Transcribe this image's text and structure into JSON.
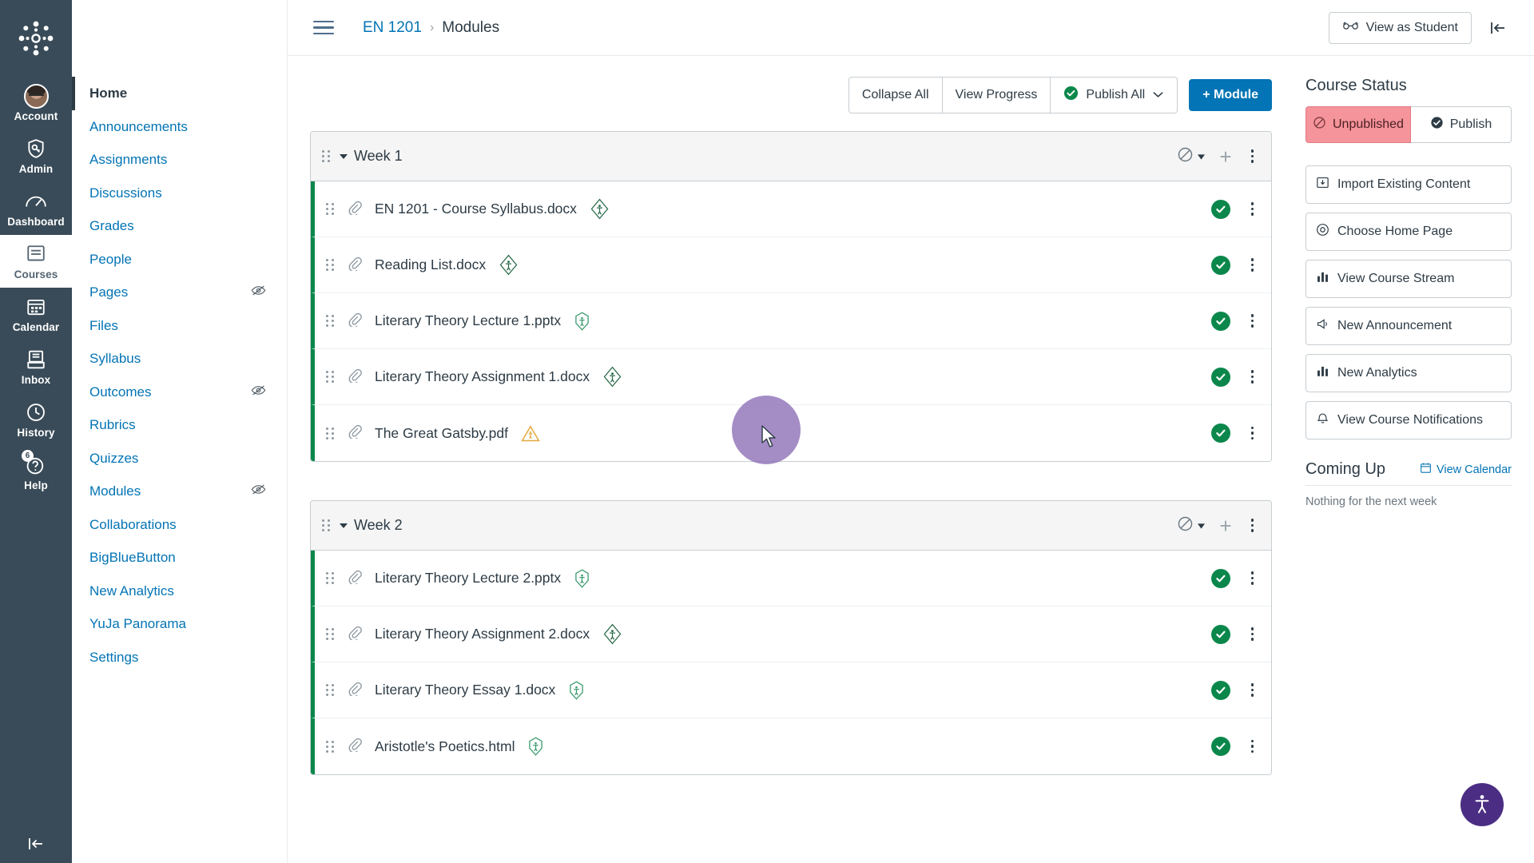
{
  "global_nav": {
    "logo": "canvas-logo",
    "items": [
      {
        "label": "Account",
        "icon": "avatar-icon",
        "active": false
      },
      {
        "label": "Admin",
        "icon": "shield-key-icon",
        "active": false
      },
      {
        "label": "Dashboard",
        "icon": "dashboard-gauge-icon",
        "active": false
      },
      {
        "label": "Courses",
        "icon": "book-icon",
        "active": true
      },
      {
        "label": "Calendar",
        "icon": "calendar-icon",
        "active": false
      },
      {
        "label": "Inbox",
        "icon": "inbox-tray-icon",
        "active": false
      },
      {
        "label": "History",
        "icon": "clock-icon",
        "active": false
      },
      {
        "label": "Help",
        "icon": "question-circle-icon",
        "active": false,
        "badge": "6"
      }
    ],
    "collapse_icon": "collapse-left-icon"
  },
  "course_nav": {
    "items": [
      {
        "label": "Home",
        "active": true,
        "hidden_icon": false
      },
      {
        "label": "Announcements",
        "active": false,
        "hidden_icon": false
      },
      {
        "label": "Assignments",
        "active": false,
        "hidden_icon": false
      },
      {
        "label": "Discussions",
        "active": false,
        "hidden_icon": false
      },
      {
        "label": "Grades",
        "active": false,
        "hidden_icon": false
      },
      {
        "label": "People",
        "active": false,
        "hidden_icon": false
      },
      {
        "label": "Pages",
        "active": false,
        "hidden_icon": true
      },
      {
        "label": "Files",
        "active": false,
        "hidden_icon": false
      },
      {
        "label": "Syllabus",
        "active": false,
        "hidden_icon": false
      },
      {
        "label": "Outcomes",
        "active": false,
        "hidden_icon": true
      },
      {
        "label": "Rubrics",
        "active": false,
        "hidden_icon": false
      },
      {
        "label": "Quizzes",
        "active": false,
        "hidden_icon": false
      },
      {
        "label": "Modules",
        "active": false,
        "hidden_icon": true
      },
      {
        "label": "Collaborations",
        "active": false,
        "hidden_icon": false
      },
      {
        "label": "BigBlueButton",
        "active": false,
        "hidden_icon": false
      },
      {
        "label": "New Analytics",
        "active": false,
        "hidden_icon": false
      },
      {
        "label": "YuJa Panorama",
        "active": false,
        "hidden_icon": false
      },
      {
        "label": "Settings",
        "active": false,
        "hidden_icon": false
      }
    ]
  },
  "topbar": {
    "menu_icon": "hamburger-menu-icon",
    "breadcrumb_course": "EN 1201",
    "breadcrumb_sep": "›",
    "breadcrumb_current": "Modules",
    "view_as_student_label": "View as Student",
    "view_as_student_icon": "eye-glasses-icon",
    "collapse_icon": "collapse-right-icon"
  },
  "module_actions": {
    "collapse_all": "Collapse All",
    "view_progress": "View Progress",
    "publish_all": "Publish All",
    "publish_all_icon": "green-check-circle-icon",
    "publish_all_caret": "chevron-down-icon",
    "add_module": "+ Module"
  },
  "modules": [
    {
      "title": "Week 1",
      "publish_state_icon": "prohibited-circle-icon",
      "add_icon": "plus-icon",
      "kebab_icon": "kebab-menu-icon",
      "items": [
        {
          "title": "EN 1201 - Course Syllabus.docx",
          "type_icon": "paperclip-icon",
          "badge": "a11y-diamond-icon",
          "published": true
        },
        {
          "title": "Reading List.docx",
          "type_icon": "paperclip-icon",
          "badge": "a11y-diamond-icon",
          "published": true
        },
        {
          "title": "Literary Theory Lecture 1.pptx",
          "type_icon": "paperclip-icon",
          "badge": "a11y-hexagon-icon",
          "published": true
        },
        {
          "title": "Literary Theory Assignment 1.docx",
          "type_icon": "paperclip-icon",
          "badge": "a11y-diamond-icon",
          "published": true
        },
        {
          "title": "The Great Gatsby.pdf",
          "type_icon": "paperclip-icon",
          "badge": "a11y-warning-triangle-icon",
          "published": true
        }
      ]
    },
    {
      "title": "Week 2",
      "publish_state_icon": "prohibited-circle-icon",
      "add_icon": "plus-icon",
      "kebab_icon": "kebab-menu-icon",
      "items": [
        {
          "title": "Literary Theory Lecture 2.pptx",
          "type_icon": "paperclip-icon",
          "badge": "a11y-hexagon-icon",
          "published": true
        },
        {
          "title": "Literary Theory Assignment 2.docx",
          "type_icon": "paperclip-icon",
          "badge": "a11y-diamond-icon",
          "published": true
        },
        {
          "title": "Literary Theory Essay 1.docx",
          "type_icon": "paperclip-icon",
          "badge": "a11y-hexagon-icon",
          "published": true
        },
        {
          "title": "Aristotle's Poetics.html",
          "type_icon": "paperclip-icon",
          "badge": "a11y-hexagon-icon",
          "published": true
        }
      ]
    }
  ],
  "sidebar": {
    "course_status_title": "Course Status",
    "unpublished_label": "Unpublished",
    "unpublished_icon": "prohibited-circle-icon",
    "publish_label": "Publish",
    "publish_icon": "check-circle-icon",
    "buttons": [
      {
        "label": "Import Existing Content",
        "icon": "import-icon"
      },
      {
        "label": "Choose Home Page",
        "icon": "home-target-icon"
      },
      {
        "label": "View Course Stream",
        "icon": "bar-chart-icon"
      },
      {
        "label": "New Announcement",
        "icon": "megaphone-icon"
      },
      {
        "label": "New Analytics",
        "icon": "bar-chart-icon"
      },
      {
        "label": "View Course Notifications",
        "icon": "bell-icon"
      }
    ],
    "coming_up_title": "Coming Up",
    "view_calendar_label": "View Calendar",
    "view_calendar_icon": "calendar-icon",
    "nothing_text": "Nothing for the next week"
  },
  "overlays": {
    "accessibility_fab_icon": "accessibility-person-icon",
    "cursor_icon": "mouse-pointer-icon"
  },
  "colors": {
    "brand_blue": "#0374B5",
    "nav_dark": "#394B58",
    "published_green": "#0b874b",
    "unpublished_red": "#f5949a",
    "warning_orange": "#e5a83b",
    "text_dark": "#2D3B45"
  }
}
